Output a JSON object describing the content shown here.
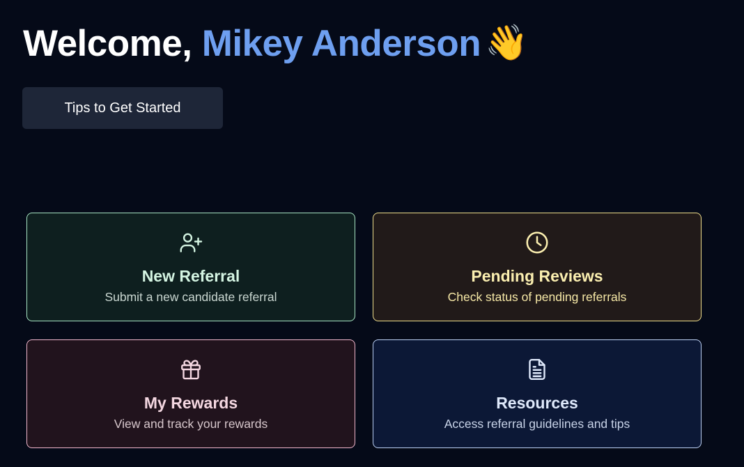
{
  "header": {
    "greeting": "Welcome,",
    "user_name": "Mikey Anderson",
    "wave_emoji": "👋"
  },
  "tips_button": {
    "label": "Tips to Get Started"
  },
  "cards": [
    {
      "title": "New Referral",
      "description": "Submit a new candidate referral",
      "icon": "user-plus-icon",
      "accent": "#a8e6c4"
    },
    {
      "title": "Pending Reviews",
      "description": "Check status of pending referrals",
      "icon": "clock-icon",
      "accent": "#f1df8c"
    },
    {
      "title": "My Rewards",
      "description": "View and track your rewards",
      "icon": "gift-icon",
      "accent": "#f1b7cd"
    },
    {
      "title": "Resources",
      "description": "Access referral guidelines and tips",
      "icon": "document-icon",
      "accent": "#bcd0f4"
    }
  ],
  "colors": {
    "background": "#050a18",
    "name_highlight": "#6e9ff0",
    "button_bg": "#1e2638"
  }
}
